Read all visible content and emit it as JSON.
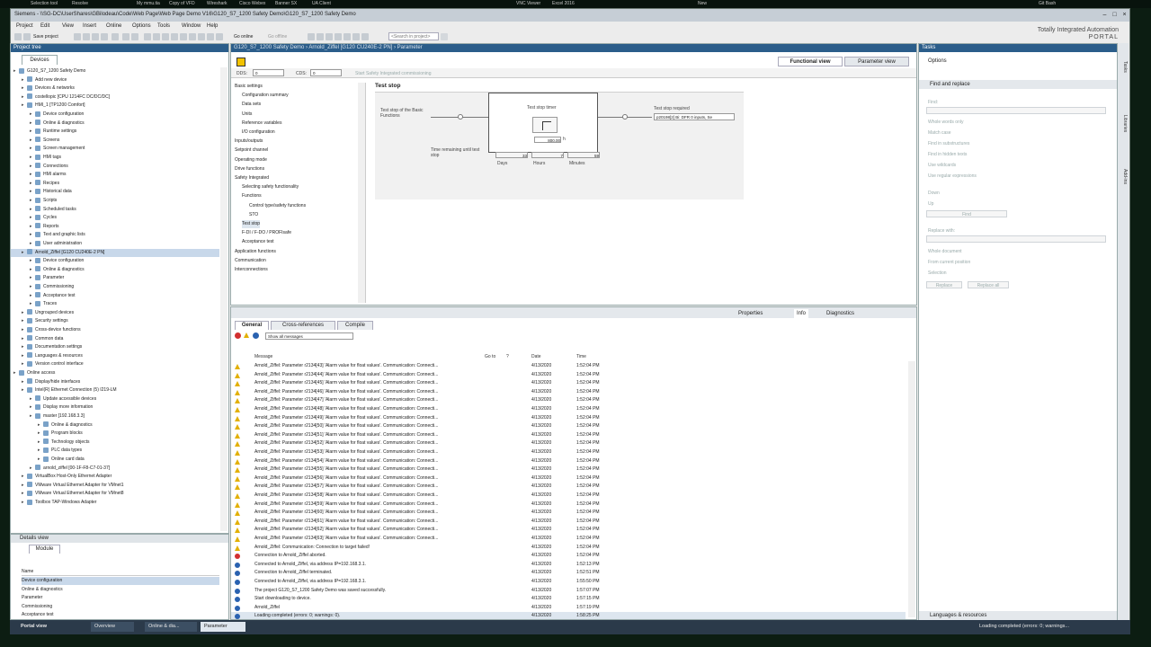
{
  "host": {
    "items": [
      "Selection tool",
      "Resolve",
      "My mmu.tia",
      "Copy of VFD",
      "Wireshark",
      "Cisco Webex",
      "Banner SX",
      "UA Client",
      "VNC Viewer",
      "Excel 2016",
      "New",
      "Git Bash"
    ]
  },
  "title": "Siemens - \\\\SG-DC\\UserShares\\GBilodeau\\Code\\Web Page\\Web Page Demo V16\\G120_S7_1200 Safety Demo\\G120_S7_1200 Safety Demo",
  "menu": [
    "Project",
    "Edit",
    "View",
    "Insert",
    "Online",
    "Options",
    "Tools",
    "Window",
    "Help"
  ],
  "toolbar": {
    "save": "Save project",
    "go_online": "Go online",
    "go_offline": "Go offline",
    "search_placeholder": "<Search in project>"
  },
  "brand": {
    "line1": "Totally Integrated Automation",
    "line2": "PORTAL"
  },
  "project_tree": {
    "header": "Project tree",
    "tab": "Devices",
    "items": [
      {
        "l": "G120_S7_1200 Safety Demo",
        "d": 0
      },
      {
        "l": "Add new device",
        "d": 1
      },
      {
        "l": "Devices & networks",
        "d": 1
      },
      {
        "l": "costellopic [CPU 1214FC DC/DC/DC]",
        "d": 1
      },
      {
        "l": "HMI_1 [TP1200 Comfort]",
        "d": 1
      },
      {
        "l": "Device configuration",
        "d": 2
      },
      {
        "l": "Online & diagnostics",
        "d": 2
      },
      {
        "l": "Runtime settings",
        "d": 2
      },
      {
        "l": "Screens",
        "d": 2
      },
      {
        "l": "Screen management",
        "d": 2
      },
      {
        "l": "HMI tags",
        "d": 2
      },
      {
        "l": "Connections",
        "d": 2
      },
      {
        "l": "HMI alarms",
        "d": 2
      },
      {
        "l": "Recipes",
        "d": 2
      },
      {
        "l": "Historical data",
        "d": 2
      },
      {
        "l": "Scripts",
        "d": 2
      },
      {
        "l": "Scheduled tasks",
        "d": 2
      },
      {
        "l": "Cycles",
        "d": 2
      },
      {
        "l": "Reports",
        "d": 2
      },
      {
        "l": "Text and graphic lists",
        "d": 2
      },
      {
        "l": "User administration",
        "d": 2
      },
      {
        "l": "Arnold_Ziffel [G120 CU240E-2 PN]",
        "d": 1,
        "sel": true
      },
      {
        "l": "Device configuration",
        "d": 2
      },
      {
        "l": "Online & diagnostics",
        "d": 2
      },
      {
        "l": "Parameter",
        "d": 2
      },
      {
        "l": "Commissioning",
        "d": 2
      },
      {
        "l": "Acceptance test",
        "d": 2
      },
      {
        "l": "Traces",
        "d": 2
      },
      {
        "l": "Ungrouped devices",
        "d": 1
      },
      {
        "l": "Security settings",
        "d": 1
      },
      {
        "l": "Cross-device functions",
        "d": 1
      },
      {
        "l": "Common data",
        "d": 1
      },
      {
        "l": "Documentation settings",
        "d": 1
      },
      {
        "l": "Languages & resources",
        "d": 1
      },
      {
        "l": "Version control interface",
        "d": 1
      },
      {
        "l": "Online access",
        "d": 0
      },
      {
        "l": "Display/hide interfaces",
        "d": 1
      },
      {
        "l": "Intel(R) Ethernet Connection (5) I219-LM",
        "d": 1
      },
      {
        "l": "Update accessible devices",
        "d": 2
      },
      {
        "l": "Display more information",
        "d": 2
      },
      {
        "l": "master [192.168.3.3]",
        "d": 2
      },
      {
        "l": "Online & diagnostics",
        "d": 3
      },
      {
        "l": "Program blocks",
        "d": 3
      },
      {
        "l": "Technology objects",
        "d": 3
      },
      {
        "l": "PLC data types",
        "d": 3
      },
      {
        "l": "Online card data",
        "d": 3
      },
      {
        "l": "arnold_ziffel [00-1F-F8-C7-01-37]",
        "d": 2
      },
      {
        "l": "VirtualBox Host-Only Ethernet Adapter",
        "d": 1
      },
      {
        "l": "VMware Virtual Ethernet Adapter for VMnet1",
        "d": 1
      },
      {
        "l": "VMware Virtual Ethernet Adapter for VMnet8",
        "d": 1
      },
      {
        "l": "Toolbox TAP-Windows Adapter",
        "d": 1
      }
    ]
  },
  "details": {
    "header": "Details view",
    "tab": "Module",
    "col": "Name",
    "rows": [
      "Device configuration",
      "Online & diagnostics",
      "Parameter",
      "Commissioning",
      "Acceptance test"
    ]
  },
  "editor": {
    "breadcrumb": "G120_S7_1200 Safety Demo  ›  Arnold_Ziffel [G120 CU240E-2 PN]  ›  Parameter",
    "functional_view": "Functional view",
    "parameter_view": "Parameter view",
    "dds_label": "DDS:",
    "dds_value": "0",
    "cds_label": "CDS:",
    "cds_value": "0",
    "commissioning": "Start Safety Integrated commissioning",
    "nav": [
      {
        "l": "Basic settings",
        "d": 0
      },
      {
        "l": "Configuration summary",
        "d": 1
      },
      {
        "l": "Data sets",
        "d": 1
      },
      {
        "l": "Units",
        "d": 1
      },
      {
        "l": "Reference variables",
        "d": 1
      },
      {
        "l": "I/O configuration",
        "d": 1
      },
      {
        "l": "Inputs/outputs",
        "d": 0
      },
      {
        "l": "Setpoint channel",
        "d": 0
      },
      {
        "l": "Operating mode",
        "d": 0
      },
      {
        "l": "Drive functions",
        "d": 0
      },
      {
        "l": "Safety Integrated",
        "d": 0
      },
      {
        "l": "Selecting safety functionality",
        "d": 1
      },
      {
        "l": "Functions",
        "d": 1
      },
      {
        "l": "Control type/safety functions",
        "d": 2
      },
      {
        "l": "STO",
        "d": 2
      },
      {
        "l": "Test stop",
        "d": 1,
        "sel": true
      },
      {
        "l": "F-DI / F-DO / PROFIsafe",
        "d": 1
      },
      {
        "l": "Acceptance test",
        "d": 1
      },
      {
        "l": "Application functions",
        "d": 0
      },
      {
        "l": "Communication",
        "d": 0
      },
      {
        "l": "Interconnections",
        "d": 0
      }
    ],
    "form": {
      "title": "Test stop",
      "left_label": "Test stop of the Basic Functions",
      "timer_label": "Test stop timer",
      "timer_value": "800.00",
      "timer_unit": "h",
      "required_label": "Test stop required",
      "required_value": "p20198[2] Bi: DFR 0 inputs, Se",
      "remaining_label": "Time remaining until test stop",
      "days": "33",
      "hours": "7",
      "minutes": "59",
      "days_label": "Days",
      "hours_label": "Hours",
      "minutes_label": "Minutes"
    }
  },
  "inspector": {
    "tabs": {
      "properties": "Properties",
      "info": "Info",
      "diagnostics": "Diagnostics"
    },
    "subtabs": [
      "General",
      "Cross-references",
      "Compile"
    ],
    "filter": "Show all messages",
    "columns": [
      "Message",
      "Go to",
      "?",
      "Date",
      "Time"
    ],
    "messages": [
      {
        "t": "w",
        "m": "Arnold_Ziffel: Parameter r2134[43] 'Alarm value for float values'. Communication: Connecti...",
        "d": "4/13/2020",
        "ti": "1:52:04 PM"
      },
      {
        "t": "w",
        "m": "Arnold_Ziffel: Parameter r2134[44] 'Alarm value for float values'. Communication: Connecti...",
        "d": "4/13/2020",
        "ti": "1:52:04 PM"
      },
      {
        "t": "w",
        "m": "Arnold_Ziffel: Parameter r2134[45] 'Alarm value for float values'. Communication: Connecti...",
        "d": "4/13/2020",
        "ti": "1:52:04 PM"
      },
      {
        "t": "w",
        "m": "Arnold_Ziffel: Parameter r2134[46] 'Alarm value for float values'. Communication: Connecti...",
        "d": "4/13/2020",
        "ti": "1:52:04 PM"
      },
      {
        "t": "w",
        "m": "Arnold_Ziffel: Parameter r2134[47] 'Alarm value for float values'. Communication: Connecti...",
        "d": "4/13/2020",
        "ti": "1:52:04 PM"
      },
      {
        "t": "w",
        "m": "Arnold_Ziffel: Parameter r2134[48] 'Alarm value for float values'. Communication: Connecti...",
        "d": "4/13/2020",
        "ti": "1:52:04 PM"
      },
      {
        "t": "w",
        "m": "Arnold_Ziffel: Parameter r2134[49] 'Alarm value for float values'. Communication: Connecti...",
        "d": "4/13/2020",
        "ti": "1:52:04 PM"
      },
      {
        "t": "w",
        "m": "Arnold_Ziffel: Parameter r2134[50] 'Alarm value for float values'. Communication: Connecti...",
        "d": "4/13/2020",
        "ti": "1:52:04 PM"
      },
      {
        "t": "w",
        "m": "Arnold_Ziffel: Parameter r2134[51] 'Alarm value for float values'. Communication: Connecti...",
        "d": "4/13/2020",
        "ti": "1:52:04 PM"
      },
      {
        "t": "w",
        "m": "Arnold_Ziffel: Parameter r2134[52] 'Alarm value for float values'. Communication: Connecti...",
        "d": "4/13/2020",
        "ti": "1:52:04 PM"
      },
      {
        "t": "w",
        "m": "Arnold_Ziffel: Parameter r2134[53] 'Alarm value for float values'. Communication: Connecti...",
        "d": "4/13/2020",
        "ti": "1:52:04 PM"
      },
      {
        "t": "w",
        "m": "Arnold_Ziffel: Parameter r2134[54] 'Alarm value for float values'. Communication: Connecti...",
        "d": "4/13/2020",
        "ti": "1:52:04 PM"
      },
      {
        "t": "w",
        "m": "Arnold_Ziffel: Parameter r2134[55] 'Alarm value for float values'. Communication: Connecti...",
        "d": "4/13/2020",
        "ti": "1:52:04 PM"
      },
      {
        "t": "w",
        "m": "Arnold_Ziffel: Parameter r2134[56] 'Alarm value for float values'. Communication: Connecti...",
        "d": "4/13/2020",
        "ti": "1:52:04 PM"
      },
      {
        "t": "w",
        "m": "Arnold_Ziffel: Parameter r2134[57] 'Alarm value for float values'. Communication: Connecti...",
        "d": "4/13/2020",
        "ti": "1:52:04 PM"
      },
      {
        "t": "w",
        "m": "Arnold_Ziffel: Parameter r2134[58] 'Alarm value for float values'. Communication: Connecti...",
        "d": "4/13/2020",
        "ti": "1:52:04 PM"
      },
      {
        "t": "w",
        "m": "Arnold_Ziffel: Parameter r2134[59] 'Alarm value for float values'. Communication: Connecti...",
        "d": "4/13/2020",
        "ti": "1:52:04 PM"
      },
      {
        "t": "w",
        "m": "Arnold_Ziffel: Parameter r2134[60] 'Alarm value for float values'. Communication: Connecti...",
        "d": "4/13/2020",
        "ti": "1:52:04 PM"
      },
      {
        "t": "w",
        "m": "Arnold_Ziffel: Parameter r2134[61] 'Alarm value for float values'. Communication: Connecti...",
        "d": "4/13/2020",
        "ti": "1:52:04 PM"
      },
      {
        "t": "w",
        "m": "Arnold_Ziffel: Parameter r2134[62] 'Alarm value for float values'. Communication: Connecti...",
        "d": "4/13/2020",
        "ti": "1:52:04 PM"
      },
      {
        "t": "w",
        "m": "Arnold_Ziffel: Parameter r2134[63] 'Alarm value for float values'. Communication: Connecti...",
        "d": "4/13/2020",
        "ti": "1:52:04 PM"
      },
      {
        "t": "w",
        "m": "Arnold_Ziffel: Communication: Connection to target failed!",
        "d": "4/13/2020",
        "ti": "1:52:04 PM"
      },
      {
        "t": "e",
        "m": "Connection to Arnold_Ziffel aborted.",
        "d": "4/13/2020",
        "ti": "1:52:04 PM"
      },
      {
        "t": "o",
        "m": "Connected to Arnold_Ziffel, via address IP=192.168.3.1.",
        "d": "4/13/2020",
        "ti": "1:52:13 PM"
      },
      {
        "t": "o",
        "m": "Connection to Arnold_Ziffel terminated.",
        "d": "4/13/2020",
        "ti": "1:52:51 PM"
      },
      {
        "t": "o",
        "m": "Connected to Arnold_Ziffel, via address IP=192.168.3.1.",
        "d": "4/13/2020",
        "ti": "1:55:50 PM"
      },
      {
        "t": "o",
        "m": "The project G120_S7_1200 Safety Demo was saved successfully.",
        "d": "4/13/2020",
        "ti": "1:57:07 PM"
      },
      {
        "t": "o",
        "m": "Start downloading to device.",
        "d": "4/13/2020",
        "ti": "1:57:15 PM"
      },
      {
        "t": "o",
        "m": "Arnold_Ziffel",
        "d": "4/13/2020",
        "ti": "1:57:19 PM"
      },
      {
        "t": "o",
        "m": "Loading completed (errors: 0; warnings: 0).",
        "d": "4/13/2020",
        "ti": "1:58:25 PM"
      }
    ]
  },
  "tasks": {
    "header": "Tasks",
    "options": "Options",
    "section": "Find and replace",
    "find": "Find:",
    "checks": [
      "Whole words only",
      "Match case",
      "Find in substructures",
      "Find in hidden texts",
      "Use wildcards",
      "Use regular expressions"
    ],
    "down": "Down",
    "up": "Up",
    "find_btn": "Find",
    "replace_with": "Replace with:",
    "scope": [
      "Whole document",
      "From current position",
      "Selection"
    ],
    "replace_btn": "Replace",
    "replace_all_btn": "Replace all",
    "languages": "Languages & resources"
  },
  "sidetabs": [
    "Tasks",
    "Libraries",
    "Add-ins"
  ],
  "status": {
    "portal": "Portal view",
    "overview": "Overview",
    "online": "Online & dia...",
    "parameter": "Parameter",
    "message": "Loading completed (errors: 0; warnings..."
  }
}
